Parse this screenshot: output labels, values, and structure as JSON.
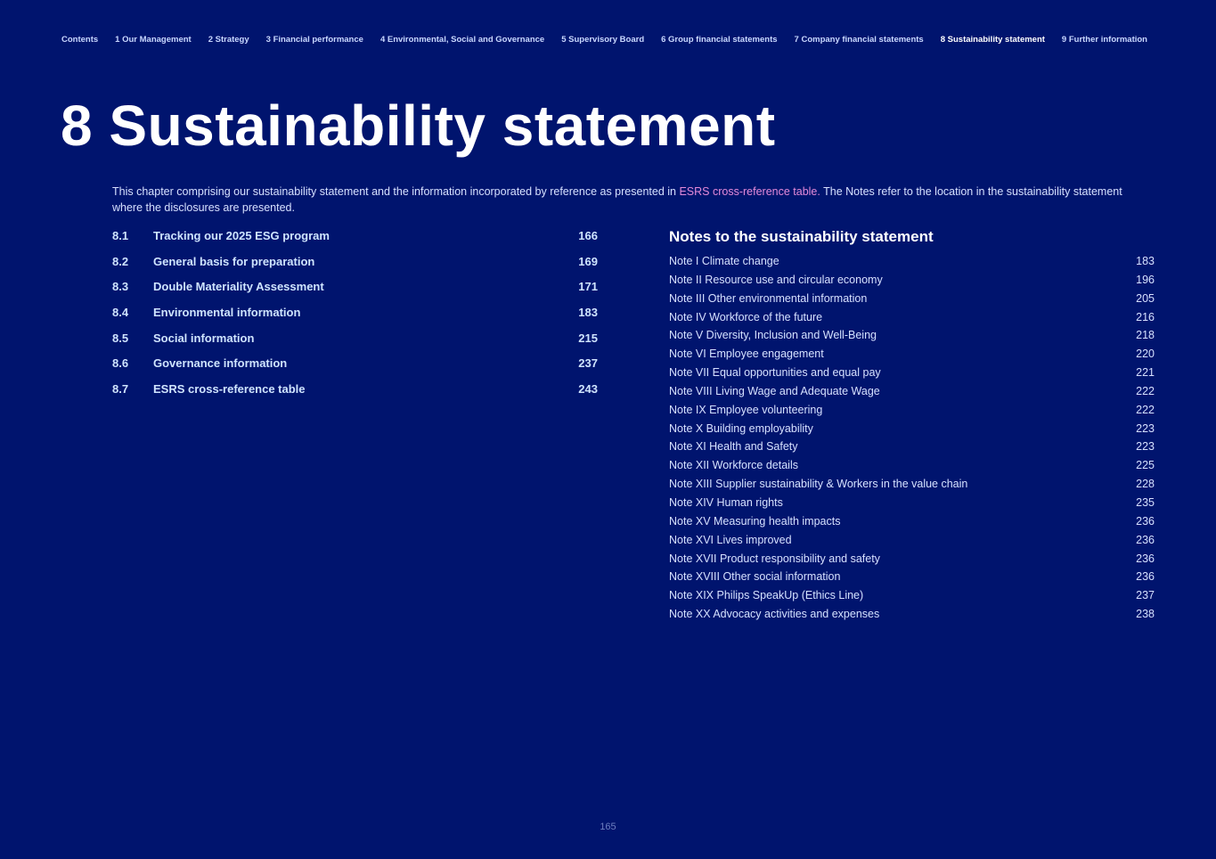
{
  "nav": [
    "Contents",
    "1 Our Management",
    "2 Strategy",
    "3 Financial performance",
    "4 Environmental, Social and Governance",
    "5 Supervisory Board",
    "6 Group financial statements",
    "7 Company financial statements",
    "8 Sustainability statement",
    "9 Further information"
  ],
  "title": "8 Sustainability statement",
  "intro": {
    "before": "This chapter comprising our sustainability statement and the information incorporated by reference as presented in ",
    "link": "ESRS cross-reference table.",
    "after": " The Notes refer to the location in the sustainability statement where the disclosures are presented."
  },
  "toc": [
    {
      "num": "8.1",
      "title": "Tracking our 2025 ESG program",
      "page": "166"
    },
    {
      "num": "8.2",
      "title": "General basis for preparation",
      "page": "169"
    },
    {
      "num": "8.3",
      "title": "Double Materiality Assessment",
      "page": "171"
    },
    {
      "num": "8.4",
      "title": "Environmental information",
      "page": "183"
    },
    {
      "num": "8.5",
      "title": "Social information",
      "page": "215"
    },
    {
      "num": "8.6",
      "title": "Governance information",
      "page": "237"
    },
    {
      "num": "8.7",
      "title": "ESRS cross-reference table",
      "page": "243"
    }
  ],
  "notes_heading": "Notes to the sustainability statement",
  "notes": [
    {
      "title": "Note I Climate change",
      "page": "183"
    },
    {
      "title": "Note II Resource use and circular economy",
      "page": "196"
    },
    {
      "title": "Note III Other environmental information",
      "page": "205"
    },
    {
      "title": "Note IV Workforce of the future",
      "page": "216"
    },
    {
      "title": "Note V Diversity, Inclusion and Well-Being",
      "page": "218"
    },
    {
      "title": "Note VI Employee engagement",
      "page": "220"
    },
    {
      "title": "Note VII Equal opportunities and equal pay",
      "page": "221"
    },
    {
      "title": "Note VIII Living Wage and Adequate Wage",
      "page": "222"
    },
    {
      "title": "Note IX Employee volunteering",
      "page": "222"
    },
    {
      "title": "Note X Building employability",
      "page": "223"
    },
    {
      "title": "Note XI Health and Safety",
      "page": "223"
    },
    {
      "title": "Note XII Workforce details",
      "page": "225"
    },
    {
      "title": "Note XIII Supplier sustainability & Workers in the value chain",
      "page": "228"
    },
    {
      "title": "Note XIV Human rights",
      "page": "235"
    },
    {
      "title": "Note XV Measuring health impacts",
      "page": "236"
    },
    {
      "title": "Note XVI Lives improved",
      "page": "236"
    },
    {
      "title": "Note XVII Product responsibility and safety",
      "page": "236"
    },
    {
      "title": "Note XVIII Other social information",
      "page": "236"
    },
    {
      "title": "Note XIX Philips SpeakUp (Ethics Line)",
      "page": "237"
    },
    {
      "title": "Note XX Advocacy activities and expenses",
      "page": "238"
    }
  ],
  "page_number": "165"
}
